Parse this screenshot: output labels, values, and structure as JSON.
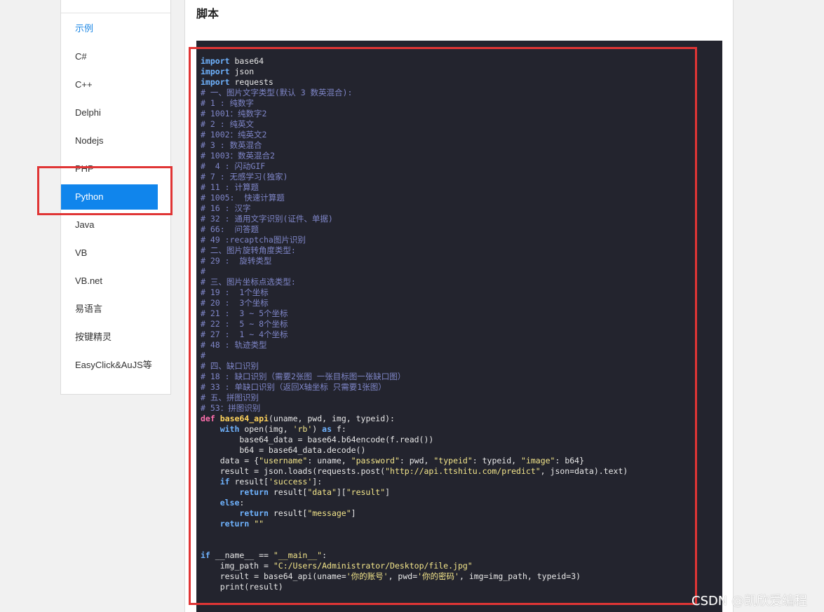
{
  "sidebar": {
    "items": [
      {
        "label": "示例"
      },
      {
        "label": "C#"
      },
      {
        "label": "C++"
      },
      {
        "label": "Delphi"
      },
      {
        "label": "Nodejs"
      },
      {
        "label": "PHP"
      },
      {
        "label": "Python"
      },
      {
        "label": "Java"
      },
      {
        "label": "VB"
      },
      {
        "label": "VB.net"
      },
      {
        "label": "易语言"
      },
      {
        "label": "按键精灵"
      },
      {
        "label": "EasyClick&AuJS等"
      }
    ],
    "active_index": 6
  },
  "main": {
    "title": "脚本",
    "code_lines": [
      [
        [
          "kw",
          "import"
        ],
        [
          "t",
          " base64"
        ]
      ],
      [
        [
          "kw",
          "import"
        ],
        [
          "t",
          " json"
        ]
      ],
      [
        [
          "kw",
          "import"
        ],
        [
          "t",
          " requests"
        ]
      ],
      [
        [
          "cm",
          "# 一、图片文字类型(默认 3 数英混合):"
        ]
      ],
      [
        [
          "cm",
          "# 1 : 纯数字"
        ]
      ],
      [
        [
          "cm",
          "# 1001：纯数字2"
        ]
      ],
      [
        [
          "cm",
          "# 2 : 纯英文"
        ]
      ],
      [
        [
          "cm",
          "# 1002：纯英文2"
        ]
      ],
      [
        [
          "cm",
          "# 3 : 数英混合"
        ]
      ],
      [
        [
          "cm",
          "# 1003：数英混合2"
        ]
      ],
      [
        [
          "cm",
          "#  4 : 闪动GIF"
        ]
      ],
      [
        [
          "cm",
          "# 7 : 无感学习(独家)"
        ]
      ],
      [
        [
          "cm",
          "# 11 : 计算题"
        ]
      ],
      [
        [
          "cm",
          "# 1005:  快速计算题"
        ]
      ],
      [
        [
          "cm",
          "# 16 : 汉字"
        ]
      ],
      [
        [
          "cm",
          "# 32 : 通用文字识别(证件、单据)"
        ]
      ],
      [
        [
          "cm",
          "# 66:  问答题"
        ]
      ],
      [
        [
          "cm",
          "# 49 :recaptcha图片识别"
        ]
      ],
      [
        [
          "cm",
          "# 二、图片旋转角度类型:"
        ]
      ],
      [
        [
          "cm",
          "# 29 :  旋转类型"
        ]
      ],
      [
        [
          "cm",
          "#"
        ]
      ],
      [
        [
          "cm",
          "# 三、图片坐标点选类型:"
        ]
      ],
      [
        [
          "cm",
          "# 19 :  1个坐标"
        ]
      ],
      [
        [
          "cm",
          "# 20 :  3个坐标"
        ]
      ],
      [
        [
          "cm",
          "# 21 :  3 ~ 5个坐标"
        ]
      ],
      [
        [
          "cm",
          "# 22 :  5 ~ 8个坐标"
        ]
      ],
      [
        [
          "cm",
          "# 27 :  1 ~ 4个坐标"
        ]
      ],
      [
        [
          "cm",
          "# 48 : 轨迹类型"
        ]
      ],
      [
        [
          "cm",
          "#"
        ]
      ],
      [
        [
          "cm",
          "# 四、缺口识别"
        ]
      ],
      [
        [
          "cm",
          "# 18 : 缺口识别（需要2张图 一张目标图一张缺口图）"
        ]
      ],
      [
        [
          "cm",
          "# 33 : 单缺口识别（返回X轴坐标 只需要1张图）"
        ]
      ],
      [
        [
          "cm",
          "# 五、拼图识别"
        ]
      ],
      [
        [
          "cm",
          "# 53：拼图识别"
        ]
      ],
      [
        [
          "kw2",
          "def"
        ],
        [
          "t",
          " "
        ],
        [
          "fn",
          "base64_api"
        ],
        [
          "t",
          "(uname, pwd, img, typeid):"
        ]
      ],
      [
        [
          "t",
          "    "
        ],
        [
          "kw",
          "with"
        ],
        [
          "t",
          " open(img, "
        ],
        [
          "str",
          "'rb'"
        ],
        [
          "t",
          ") "
        ],
        [
          "kw",
          "as"
        ],
        [
          "t",
          " f:"
        ]
      ],
      [
        [
          "t",
          "        base64_data = base64.b64encode(f.read())"
        ]
      ],
      [
        [
          "t",
          "        b64 = base64_data.decode()"
        ]
      ],
      [
        [
          "t",
          "    data = {"
        ],
        [
          "str",
          "\"username\""
        ],
        [
          "t",
          ": uname, "
        ],
        [
          "str",
          "\"password\""
        ],
        [
          "t",
          ": pwd, "
        ],
        [
          "str",
          "\"typeid\""
        ],
        [
          "t",
          ": typeid, "
        ],
        [
          "str",
          "\"image\""
        ],
        [
          "t",
          ": b64}"
        ]
      ],
      [
        [
          "t",
          "    result = json.loads(requests.post("
        ],
        [
          "str",
          "\"http://api.ttshitu.com/predict\""
        ],
        [
          "t",
          ", json=data).text)"
        ]
      ],
      [
        [
          "t",
          "    "
        ],
        [
          "kw",
          "if"
        ],
        [
          "t",
          " result["
        ],
        [
          "str",
          "'success'"
        ],
        [
          "t",
          "]:"
        ]
      ],
      [
        [
          "t",
          "        "
        ],
        [
          "kw",
          "return"
        ],
        [
          "t",
          " result["
        ],
        [
          "str",
          "\"data\""
        ],
        [
          "t",
          "]["
        ],
        [
          "str",
          "\"result\""
        ],
        [
          "t",
          "]"
        ]
      ],
      [
        [
          "t",
          "    "
        ],
        [
          "kw",
          "else"
        ],
        [
          "t",
          ":"
        ]
      ],
      [
        [
          "t",
          "        "
        ],
        [
          "kw",
          "return"
        ],
        [
          "t",
          " result["
        ],
        [
          "str",
          "\"message\""
        ],
        [
          "t",
          "]"
        ]
      ],
      [
        [
          "t",
          "    "
        ],
        [
          "kw",
          "return"
        ],
        [
          "t",
          " "
        ],
        [
          "str",
          "\"\""
        ]
      ],
      [
        [
          "t",
          ""
        ]
      ],
      [
        [
          "t",
          ""
        ]
      ],
      [
        [
          "kw",
          "if"
        ],
        [
          "t",
          " __name__ == "
        ],
        [
          "str",
          "\"__main__\""
        ],
        [
          "t",
          ":"
        ]
      ],
      [
        [
          "t",
          "    img_path = "
        ],
        [
          "str",
          "\"C:/Users/Administrator/Desktop/file.jpg\""
        ]
      ],
      [
        [
          "t",
          "    result = base64_api(uname="
        ],
        [
          "str",
          "'你的账号'"
        ],
        [
          "t",
          ", pwd="
        ],
        [
          "str",
          "'你的密码'"
        ],
        [
          "t",
          ", img=img_path, typeid=3)"
        ]
      ],
      [
        [
          "t",
          "    print(result)"
        ]
      ]
    ]
  },
  "watermark": "CSDN @凯欣爱编程",
  "colors": {
    "active_nav_bg": "#1085ec",
    "highlight_box": "#e03535",
    "code_bg": "#23242e"
  }
}
